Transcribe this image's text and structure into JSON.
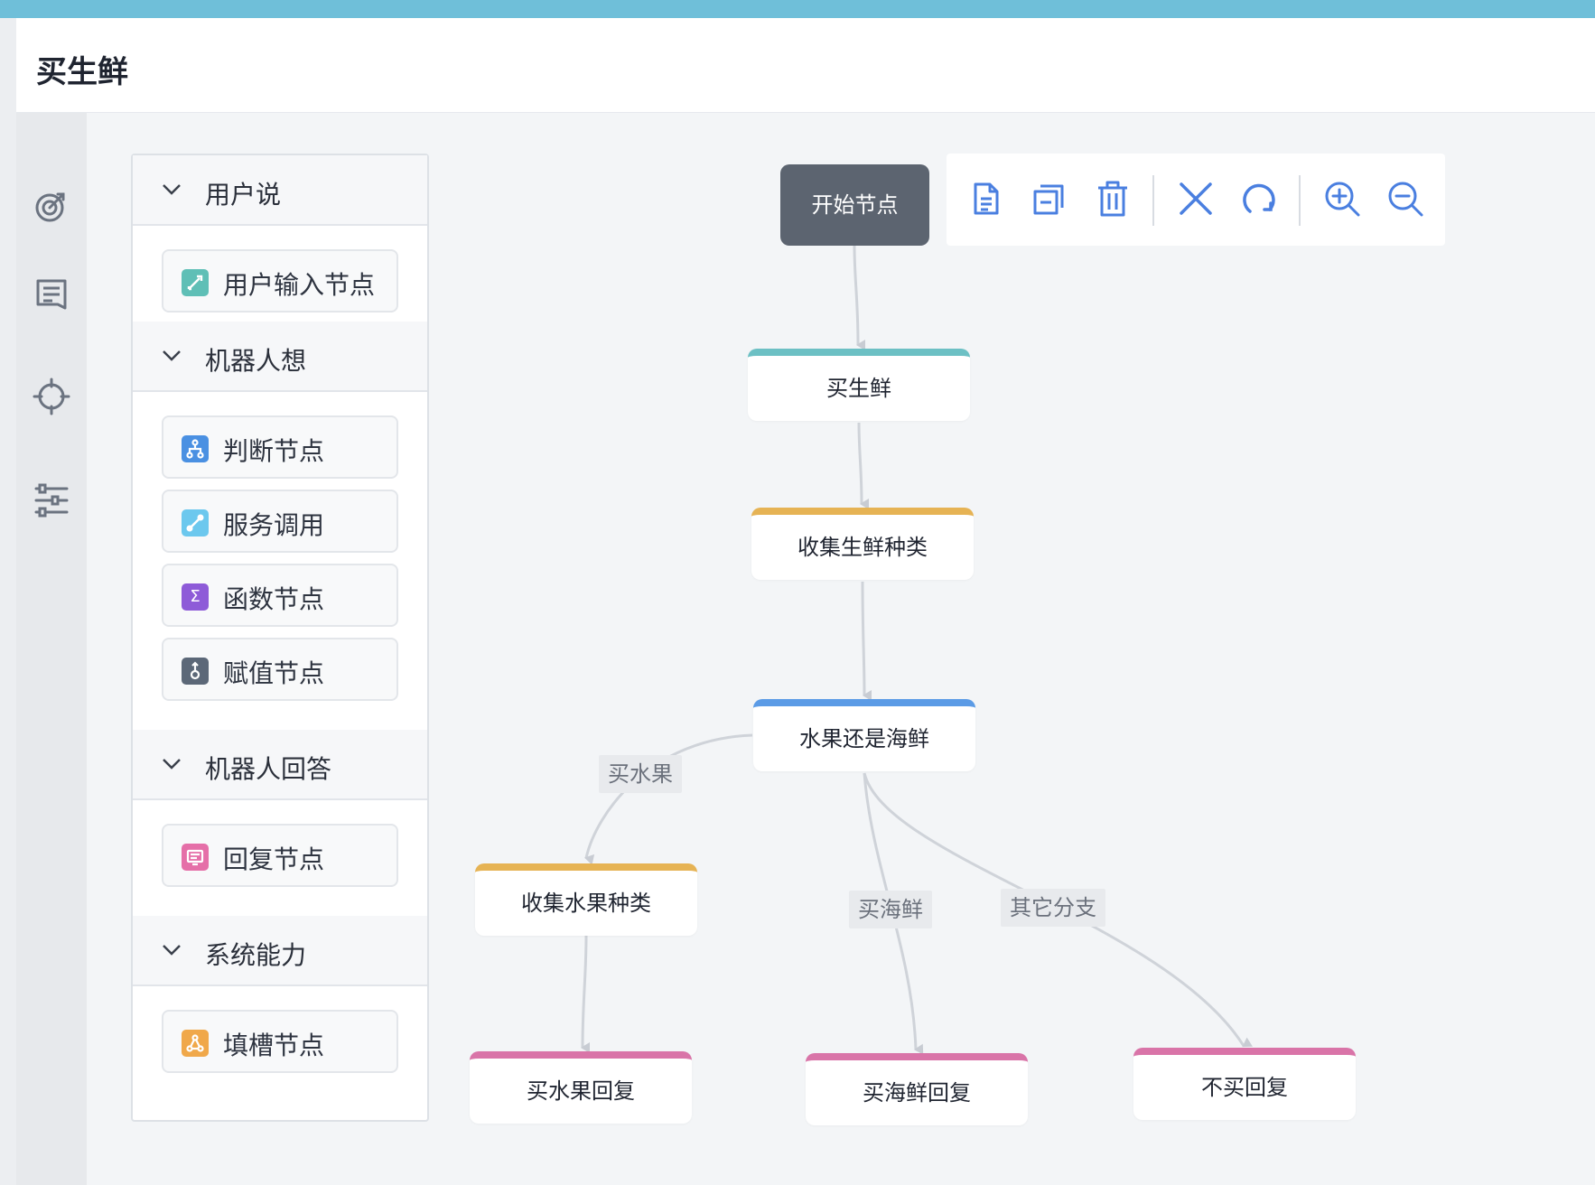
{
  "header": {
    "title": "买生鲜"
  },
  "rail": {
    "items": [
      {
        "icon": "target-icon"
      },
      {
        "icon": "document-icon"
      },
      {
        "icon": "crosshair-icon"
      },
      {
        "icon": "sliders-icon"
      }
    ]
  },
  "palette": {
    "sections": [
      {
        "title": "用户说",
        "items": [
          {
            "label": "用户输入节点",
            "icon": "edit-icon",
            "color": "#5fbfb6"
          }
        ]
      },
      {
        "title": "机器人想",
        "items": [
          {
            "label": "判断节点",
            "icon": "branch-icon",
            "color": "#4a90e2"
          },
          {
            "label": "服务调用",
            "icon": "link-icon",
            "color": "#6cc8ee"
          },
          {
            "label": "函数节点",
            "icon": "sigma-icon",
            "color": "#8e5bd8"
          },
          {
            "label": "赋值节点",
            "icon": "assign-icon",
            "color": "#5c6878"
          }
        ]
      },
      {
        "title": "机器人回答",
        "items": [
          {
            "label": "回复节点",
            "icon": "reply-icon",
            "color": "#e56fa8"
          }
        ]
      },
      {
        "title": "系统能力",
        "items": [
          {
            "label": "填槽节点",
            "icon": "slot-icon",
            "color": "#f0a84a"
          }
        ]
      }
    ]
  },
  "toolbar": {
    "buttons": [
      {
        "icon": "copy-icon"
      },
      {
        "icon": "duplicate-icon"
      },
      {
        "icon": "trash-icon"
      },
      {
        "icon": "close-icon"
      },
      {
        "icon": "refresh-icon"
      },
      {
        "icon": "zoom-in-icon"
      },
      {
        "icon": "zoom-out-icon"
      }
    ]
  },
  "flow": {
    "start": {
      "label": "开始节点"
    },
    "nodes": [
      {
        "label": "买生鲜",
        "accent": "#6cc0c4"
      },
      {
        "label": "收集生鲜种类",
        "accent": "#e6b354"
      },
      {
        "label": "水果还是海鲜",
        "accent": "#5b9be6"
      },
      {
        "label": "收集水果种类",
        "accent": "#e6b354"
      },
      {
        "label": "买水果回复",
        "accent": "#d974a8"
      },
      {
        "label": "买海鲜回复",
        "accent": "#d974a8"
      },
      {
        "label": "不买回复",
        "accent": "#d974a8"
      }
    ],
    "edge_labels": [
      "买水果",
      "买海鲜",
      "其它分支"
    ]
  }
}
